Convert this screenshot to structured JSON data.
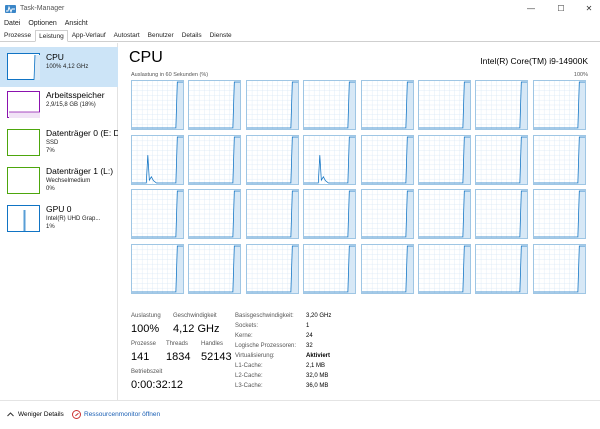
{
  "window": {
    "title": "Task-Manager",
    "minimize": "—",
    "maximize": "☐",
    "close": "✕"
  },
  "menu": [
    "Datei",
    "Optionen",
    "Ansicht"
  ],
  "tabs": [
    "Prozesse",
    "Leistung",
    "App-Verlauf",
    "Autostart",
    "Benutzer",
    "Details",
    "Dienste"
  ],
  "active_tab": "Leistung",
  "sidebar": [
    {
      "title": "CPU",
      "sub1": "100% 4,12 GHz",
      "sub2": "",
      "color": "#1174c4",
      "selected": true
    },
    {
      "title": "Arbeitsspeicher",
      "sub1": "2,9/15,8 GB (18%)",
      "sub2": "",
      "color": "#8b12ae",
      "selected": false
    },
    {
      "title": "Datenträger 0 (E: D",
      "sub1": "SSD",
      "sub2": "7%",
      "color": "#4da60c",
      "selected": false
    },
    {
      "title": "Datenträger 1 (L:)",
      "sub1": "Wechselmedium",
      "sub2": "0%",
      "color": "#4da60c",
      "selected": false
    },
    {
      "title": "GPU 0",
      "sub1": "Intel(R) UHD Grap...",
      "sub2": "1%",
      "color": "#1174c4",
      "selected": false
    }
  ],
  "main": {
    "title": "CPU",
    "model": "Intel(R) Core(TM) i9-14900K",
    "graph_caption": "Auslastung in 60 Sekunden (%)",
    "graph_max": "100%",
    "graph_color": "#1174c4",
    "grid_color": "#d9e8f4"
  },
  "stats": {
    "auslastung_label": "Auslastung",
    "auslastung_value": "100%",
    "geschwindigkeit_label": "Geschwindigkeit",
    "geschwindigkeit_value": "4,12 GHz",
    "prozesse_label": "Prozesse",
    "prozesse_value": "141",
    "threads_label": "Threads",
    "threads_value": "1834",
    "handles_label": "Handles",
    "handles_value": "52143",
    "betriebszeit_label": "Betriebszeit",
    "betriebszeit_value": "0:00:32:12"
  },
  "info": [
    {
      "label": "Basisgeschwindigkeit:",
      "value": "3,20 GHz"
    },
    {
      "label": "Sockets:",
      "value": "1"
    },
    {
      "label": "Kerne:",
      "value": "24"
    },
    {
      "label": "Logische Prozessoren:",
      "value": "32"
    },
    {
      "label": "Virtualisierung:",
      "value": "Aktiviert"
    },
    {
      "label": "L1-Cache:",
      "value": "2,1 MB"
    },
    {
      "label": "L2-Cache:",
      "value": "32,0 MB"
    },
    {
      "label": "L3-Cache:",
      "value": "36,0 MB"
    }
  ],
  "footer": {
    "fewer_details": "Weniger Details",
    "resource_monitor": "Ressourcenmonitor öffnen"
  }
}
